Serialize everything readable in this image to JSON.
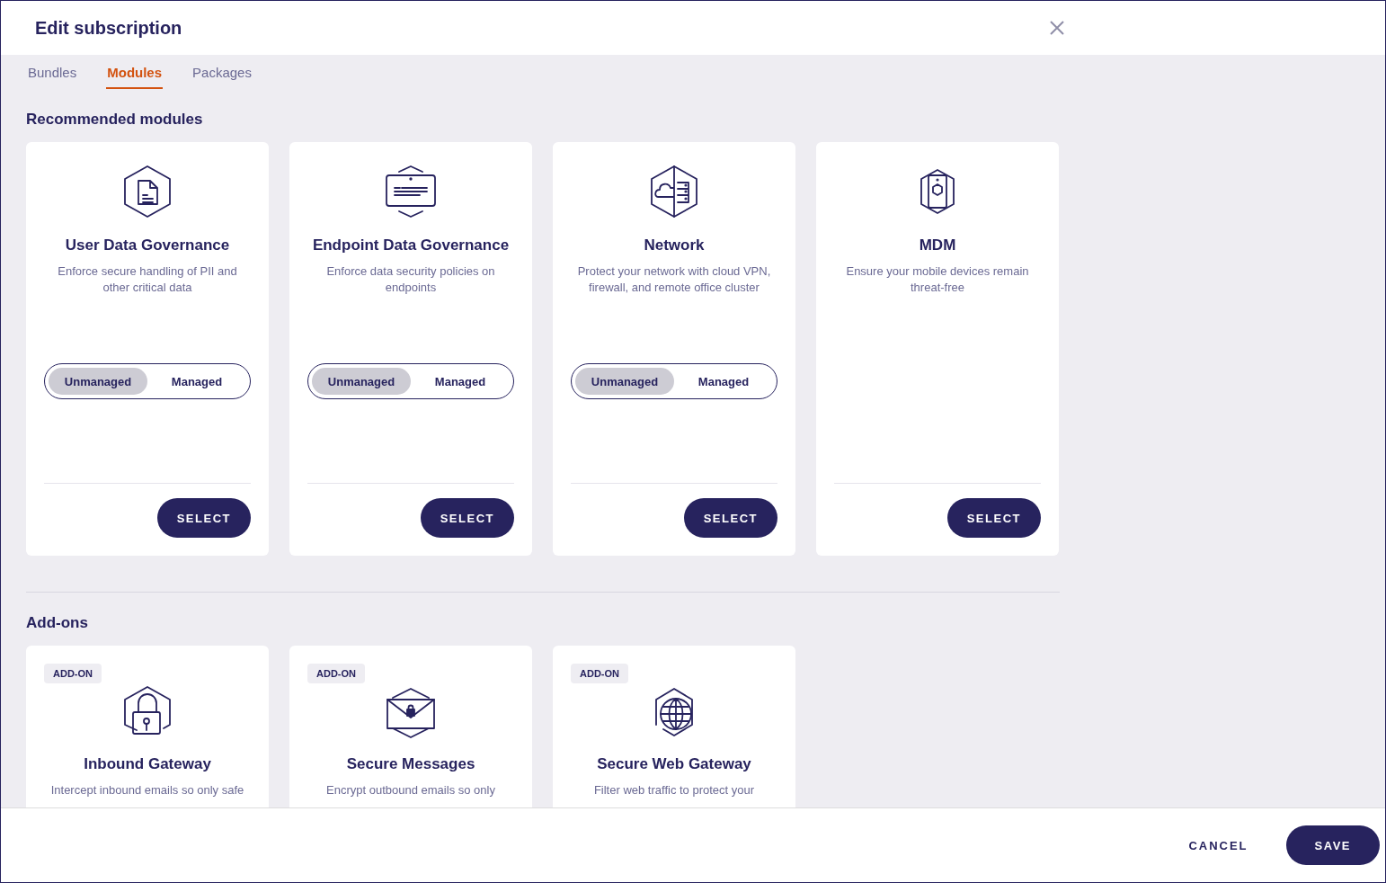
{
  "dialog": {
    "title": "Edit subscription"
  },
  "tabs": [
    {
      "label": "Bundles",
      "selected": false
    },
    {
      "label": "Modules",
      "selected": true
    },
    {
      "label": "Packages",
      "selected": false
    }
  ],
  "recommended": {
    "heading": "Recommended modules",
    "modules": [
      {
        "name": "User Data Governance",
        "description": "Enforce secure handling of PII and other critical data",
        "options": [
          {
            "label": "Unmanaged",
            "selected": true
          },
          {
            "label": "Managed",
            "selected": false
          }
        ],
        "button": "SELECT"
      },
      {
        "name": "Endpoint Data Governance",
        "description": "Enforce data security policies on endpoints",
        "options": [
          {
            "label": "Unmanaged",
            "selected": true
          },
          {
            "label": "Managed",
            "selected": false
          }
        ],
        "button": "SELECT"
      },
      {
        "name": "Network",
        "description": "Protect your network with cloud VPN, firewall, and remote office cluster",
        "options": [
          {
            "label": "Unmanaged",
            "selected": true
          },
          {
            "label": "Managed",
            "selected": false
          }
        ],
        "button": "SELECT"
      },
      {
        "name": "MDM",
        "description": "Ensure your mobile devices remain threat-free",
        "button": "SELECT"
      }
    ]
  },
  "addons": {
    "heading": "Add-ons",
    "items": [
      {
        "badge": "ADD-ON",
        "name": "Inbound Gateway",
        "description": "Intercept inbound emails so only safe"
      },
      {
        "badge": "ADD-ON",
        "name": "Secure Messages",
        "description": "Encrypt outbound emails so only"
      },
      {
        "badge": "ADD-ON",
        "name": "Secure Web Gateway",
        "description": "Filter web traffic to protect your"
      }
    ]
  },
  "footer": {
    "buttons": [
      {
        "label": "CANCEL",
        "kind": "text"
      },
      {
        "label": "SAVE",
        "kind": "primary"
      }
    ]
  }
}
